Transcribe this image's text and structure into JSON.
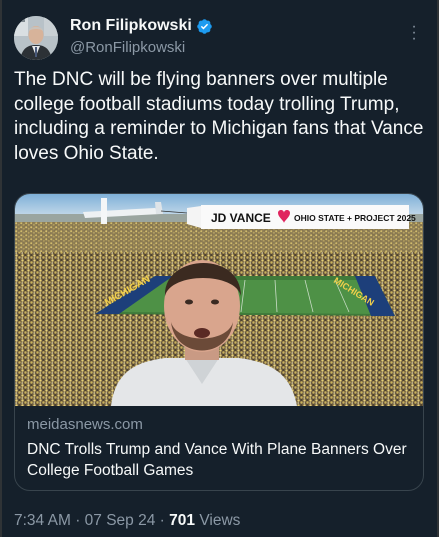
{
  "author": {
    "display_name": "Ron Filipkowski",
    "handle": "@RonFilipkowski",
    "avatar_icon": "person-avatar-icon",
    "verified_icon": "verified-badge-icon"
  },
  "tweet": {
    "text": "The DNC will be flying banners over multiple college football stadiums today trolling Trump, including a reminder to Michigan fans that Vance loves Ohio State."
  },
  "card": {
    "banner_left": "JD VANCE",
    "banner_right": "OHIO STATE + PROJECT 2025",
    "endzone_left": "MICHIGAN",
    "endzone_right": "MICHIGAN",
    "domain": "meidasnews.com",
    "title": "DNC Trolls Trump and Vance With Plane Banners Over College Football Games"
  },
  "footer": {
    "time": "7:34 AM",
    "date": "07 Sep 24",
    "separator": "·",
    "views_count": "701",
    "views_label": "Views"
  },
  "colors": {
    "background": "#15202b",
    "text_primary": "#f7f9f9",
    "text_secondary": "#8b98a5",
    "verified_blue": "#1d9bf0",
    "border": "#38444d"
  }
}
